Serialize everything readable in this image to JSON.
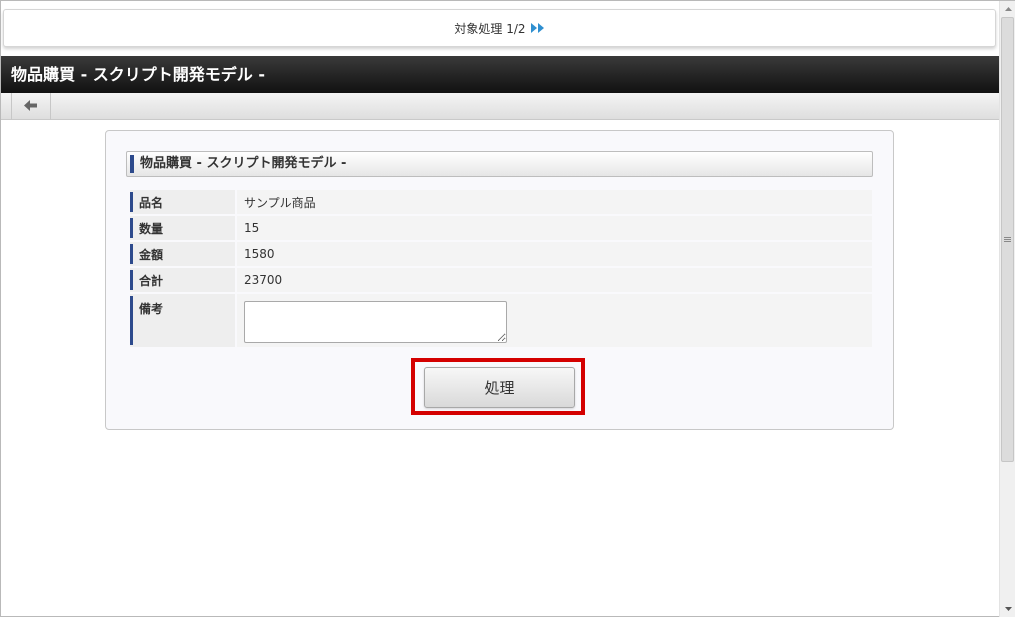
{
  "pager": {
    "text": "対象処理 1/2",
    "next_icon": "double-chevron-right-icon",
    "accent": "#2f8fd0"
  },
  "titlebar": {
    "title": "物品購買 - スクリプト開発モデル -"
  },
  "toolbar": {
    "back_icon": "arrow-left-icon"
  },
  "form": {
    "section_title": "物品購買 - スクリプト開発モデル -",
    "rows": [
      {
        "label": "品名",
        "value": "サンプル商品"
      },
      {
        "label": "数量",
        "value": "15"
      },
      {
        "label": "金額",
        "value": "1580"
      },
      {
        "label": "合計",
        "value": "23700"
      }
    ],
    "memo": {
      "label": "備考",
      "value": ""
    },
    "submit_label": "処理",
    "highlight_color": "#d40000",
    "label_accent": "#2d4a8c"
  }
}
